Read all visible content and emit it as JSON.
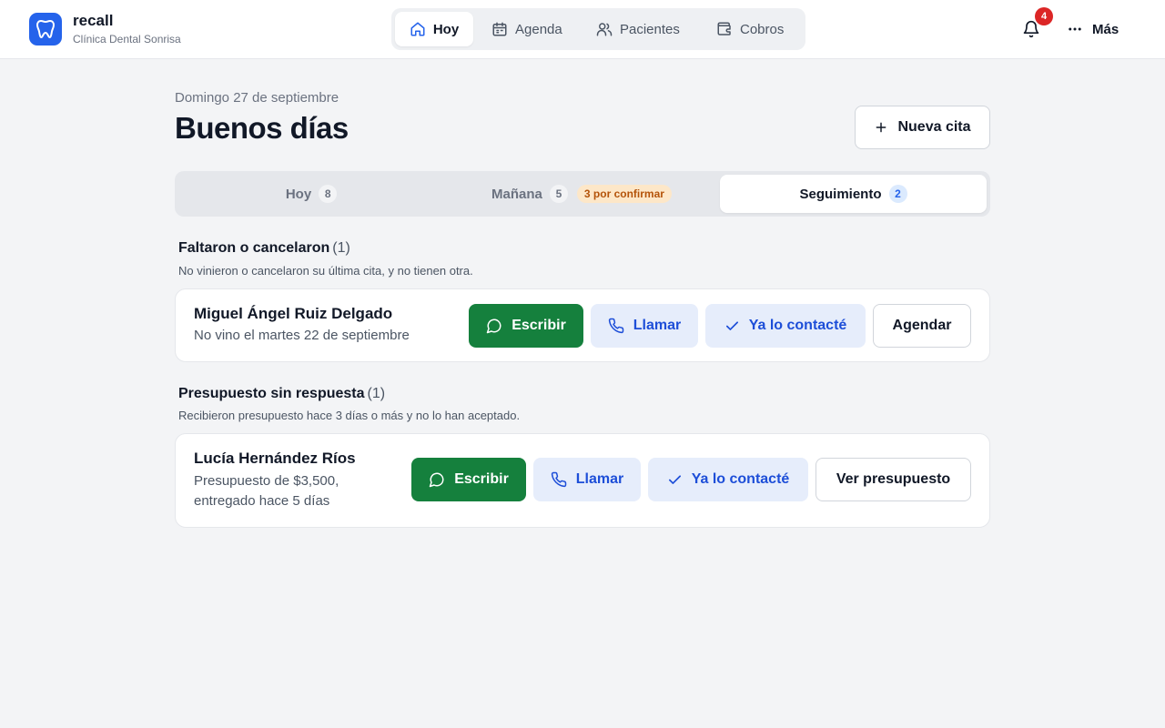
{
  "app": {
    "name": "recall",
    "clinic": "Clínica Dental Sonrisa"
  },
  "nav": {
    "items": [
      {
        "label": "Hoy",
        "icon": "home-icon",
        "active": true
      },
      {
        "label": "Agenda",
        "icon": "calendar-icon"
      },
      {
        "label": "Pacientes",
        "icon": "users-icon"
      },
      {
        "label": "Cobros",
        "icon": "wallet-icon"
      }
    ],
    "notifications_count": "4",
    "more_label": "Más"
  },
  "greeting": {
    "date": "Domingo 27 de septiembre",
    "title": "Buenos días",
    "new_button": "Nueva cita"
  },
  "tabs": [
    {
      "label": "Hoy",
      "count": "8"
    },
    {
      "label": "Mañana",
      "count": "5",
      "badge": "3 por confirmar"
    },
    {
      "label": "Seguimiento",
      "count": "2",
      "active": true
    }
  ],
  "sections": [
    {
      "title": "Faltaron o cancelaron",
      "count": "(1)",
      "description": "No vinieron o cancelaron su última cita, y no tienen otra.",
      "patient": {
        "name": "Miguel Ángel Ruiz Delgado",
        "note": "No vino el martes 22 de septiembre"
      },
      "actions": {
        "write": "Escribir",
        "call": "Llamar",
        "contacted": "Ya lo contacté",
        "secondary": "Agendar"
      }
    },
    {
      "title": "Presupuesto sin respuesta",
      "count": "(1)",
      "description": "Recibieron presupuesto hace 3 días o más y no lo han aceptado.",
      "patient": {
        "name": "Lucía Hernández Ríos",
        "note_line1": "Presupuesto de $3,500,",
        "note_line2": "entregado hace 5 días"
      },
      "actions": {
        "write": "Escribir",
        "call": "Llamar",
        "contacted": "Ya lo contacté",
        "secondary": "Ver presupuesto"
      }
    }
  ],
  "colors": {
    "brand": "#2563eb",
    "green": "#15803d",
    "blue_soft": "#e6edfb",
    "danger": "#dc2626",
    "warn_bg": "#fde7c8"
  }
}
